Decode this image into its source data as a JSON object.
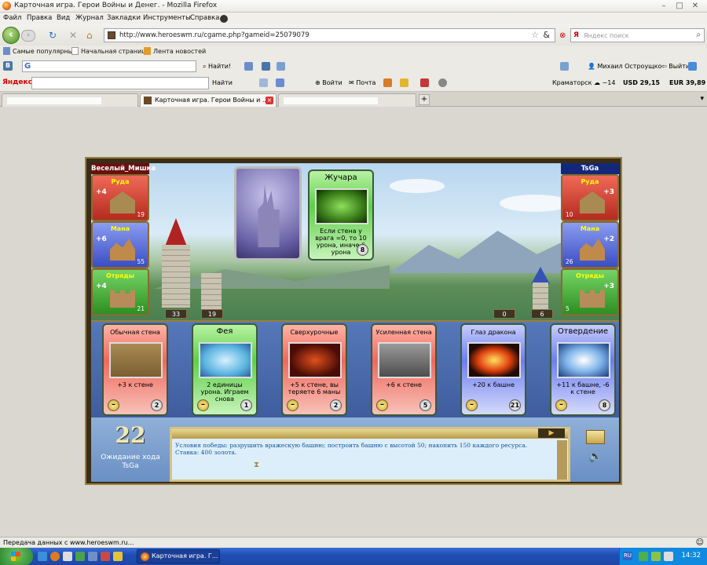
{
  "window": {
    "title": "Карточная игра. Герои Войны и Денег. - Mozilla Firefox"
  },
  "menu": [
    "Файл",
    "Правка",
    "Вид",
    "Журнал",
    "Закладки",
    "Инструменты",
    "Справка"
  ],
  "nav": {
    "url": "http://www.heroeswm.ru/cgame.php?gameid=25079079",
    "search_placeholder": "Яндекс поиск"
  },
  "bookmarks": [
    "Самые популярные",
    "Начальная страница",
    "Лента новостей"
  ],
  "toolbar1": {
    "find_label": "Найти!",
    "user_name": "Михаил Остроущко",
    "logout_label": "Выйти"
  },
  "toolbar2": {
    "brand": "Яндекс",
    "find_label": "Найти",
    "login_label": "Войти",
    "mail_label": "Почта",
    "city": "Краматорск",
    "weather": "−14",
    "usd": "USD 29,15",
    "eur": "EUR 39,89"
  },
  "tabs": [
    {
      "title": "",
      "active": false
    },
    {
      "title": "Карточная игра. Герои Войны и ...",
      "active": true
    },
    {
      "title": "",
      "active": false
    }
  ],
  "game": {
    "player_left": {
      "name": "Веселый_Мишка",
      "resources": [
        {
          "label": "Руда",
          "inc": "+4",
          "amount": "19",
          "color": "red"
        },
        {
          "label": "Мана",
          "inc": "+6",
          "amount": "55",
          "color": "blue"
        },
        {
          "label": "Отряды",
          "inc": "+4",
          "amount": "21",
          "color": "green"
        }
      ],
      "tower": "33",
      "wall": "19"
    },
    "player_right": {
      "name": "TsGa",
      "resources": [
        {
          "label": "Руда",
          "inc": "+3",
          "amount": "10",
          "color": "red"
        },
        {
          "label": "Мана",
          "inc": "+2",
          "amount": "26",
          "color": "blue"
        },
        {
          "label": "Отряды",
          "inc": "+3",
          "amount": "5",
          "color": "green"
        }
      ],
      "wall": "0",
      "tower": "6"
    },
    "played_card": {
      "title": "Жучара",
      "desc": "Если стена у врага =0, то 10 урона, иначе 6 урона",
      "cost": "8",
      "color": "green"
    },
    "hand": [
      {
        "title": "Обычная стена",
        "desc": "+3 к стене",
        "cost": "2",
        "color": "red"
      },
      {
        "title": "Фея",
        "desc": "2 единицы урона. Играем снова",
        "cost": "1",
        "color": "green"
      },
      {
        "title": "Сверхурочные",
        "desc": "+5 к стене, вы теряете 6 маны",
        "cost": "2",
        "color": "red"
      },
      {
        "title": "Усиленная стена",
        "desc": "+6 к стене",
        "cost": "5",
        "color": "red"
      },
      {
        "title": "Глаз дракона",
        "desc": "+20 к башне",
        "cost": "21",
        "color": "blue"
      },
      {
        "title": "Отвердение",
        "desc": "+11 к башне, -6 к стене",
        "cost": "8",
        "color": "blue"
      }
    ],
    "turn_counter": "22",
    "waiting_label": "Ожидание хода",
    "waiting_player": "TsGa",
    "log_text": "Условия победы: разрушить вражескую башню; построить башню с высотой 50; накопить 150 каждого ресурса. Ставка: 400 золота."
  },
  "status": "Передача данных с www.heroeswm.ru...",
  "taskbar": {
    "task_title": "Карточная игра. Г...",
    "lang": "RU",
    "clock": "14:32"
  }
}
